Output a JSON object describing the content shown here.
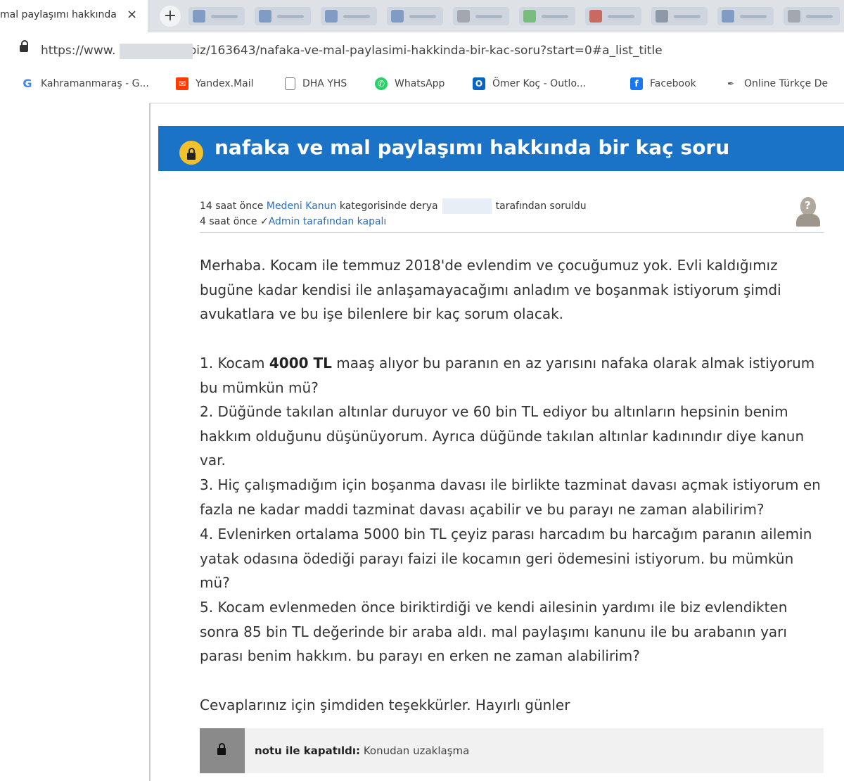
{
  "browser": {
    "tab_title": "mal paylaşımı hakkında",
    "tab_close": "×",
    "new_tab": "+",
    "url_prefix": "https://www.",
    "url_suffix": "biz/163643/nafaka-ve-mal-paylasimi-hakkinda-bir-kac-soru?start=0#a_list_title",
    "bookmarks": [
      {
        "label": "Kahramanmaraş - G...",
        "icon": "google-icon"
      },
      {
        "label": "Yandex.Mail",
        "icon": "mail-icon"
      },
      {
        "label": "DHA YHS",
        "icon": "document-icon"
      },
      {
        "label": "WhatsApp",
        "icon": "whatsapp-icon"
      },
      {
        "label": "Ömer Koç - Outlo...",
        "icon": "outlook-icon"
      },
      {
        "label": "Facebook",
        "icon": "facebook-icon"
      },
      {
        "label": "Online Türkçe De",
        "icon": "feather-icon"
      }
    ]
  },
  "question": {
    "title": "nafaka ve mal paylaşımı hakkında bir kaç soru",
    "meta_asked_prefix": "14 saat önce",
    "meta_category": "Medeni Kanun",
    "meta_asked_mid": "kategorisinde derya",
    "meta_asked_suffix": "tarafından soruldu",
    "meta_closed_prefix": "4 saat önce",
    "meta_check": "✓",
    "meta_closed_suffix": "Admin tarafından kapalı",
    "body": {
      "intro": "Merhaba. Kocam ile temmuz 2018'de evlendim ve çocuğumuz yok. Evli kaldığımız bugüne kadar kendisi ile anlaşamayacağımı anladım ve boşanmak istiyorum şimdi avukatlara ve bu işe bilenlere bir kaç sorum olacak.",
      "q1_pre": "1. Kocam",
      "q1_bold": "4000 TL",
      "q1_post": "maaş alıyor bu paranın en az yarısını nafaka olarak almak istiyorum bu mümkün mü?",
      "q2": "2. Düğünde takılan altınlar duruyor ve 60 bin TL ediyor bu altınların hepsinin benim hakkım olduğunu düşünüyorum. Ayrıca düğünde takılan altınlar kadınındır diye kanun var.",
      "q3": "3. Hiç çalışmadığım için boşanma davası ile birlikte tazminat davası açmak istiyorum en fazla ne kadar maddi tazminat davası açabilir ve bu parayı ne zaman alabilirim?",
      "q4": "4. Evlenirken ortalama 5000 bin TL çeyiz parası harcadım bu harcağım paranın ailemin yatak odasına ödediği parayı faizi ile kocamın geri ödemesini istiyorum. bu mümkün mü?",
      "q5": "5. Kocam evlenmeden önce biriktirdiği ve kendi ailesinin yardımı ile biz evlendikten sonra 85 bin TL değerinde bir araba aldı. mal paylaşımı kanunu ile bu arabanın yarı parası benim hakkım. bu parayı en erken ne zaman alabilirim?",
      "closing": "Cevaplarınız için şimdiden teşekkürler. Hayırlı günler"
    },
    "closed_note_bold": "notu ile kapatıldı:",
    "closed_note_text": "Konudan uzaklaşma"
  },
  "colors": {
    "banner": "#1b73c8",
    "link": "#2a6ebb",
    "lock_badge": "#f2c12e"
  }
}
